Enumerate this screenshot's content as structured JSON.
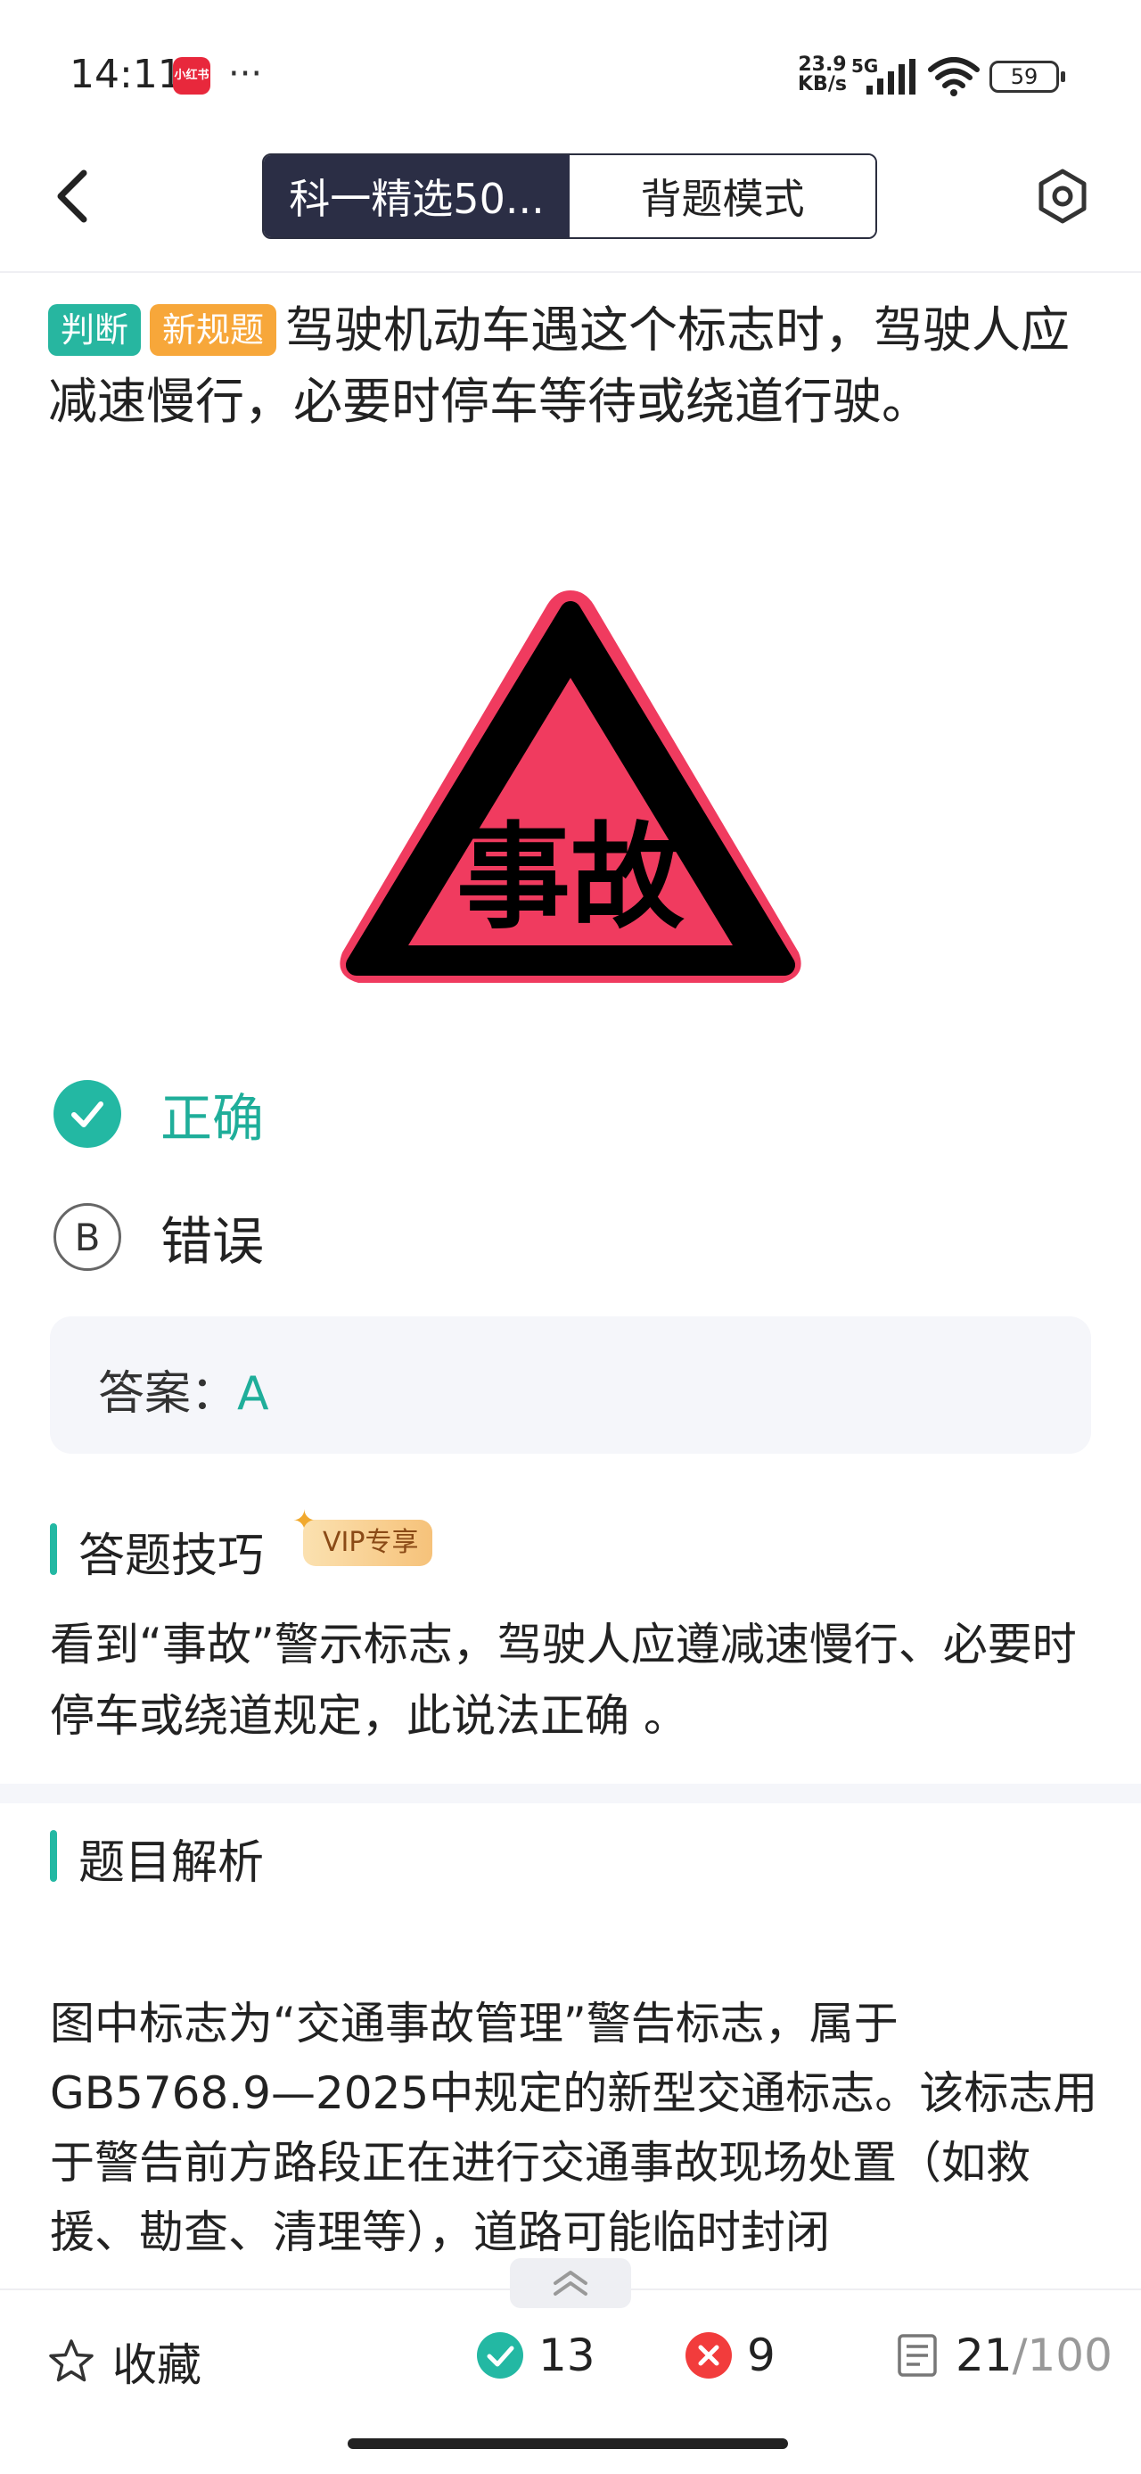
{
  "status_bar": {
    "time": "14:11",
    "app_badge": "小红书",
    "more": "···",
    "net_speed_value": "23.9",
    "net_speed_unit": "KB/s",
    "net_type": "5G",
    "battery": "59"
  },
  "header": {
    "tabs": [
      {
        "label": "科一精选50...",
        "active": true
      },
      {
        "label": "背题模式",
        "active": false
      }
    ]
  },
  "question": {
    "tags": [
      "判断",
      "新规题"
    ],
    "text": "驾驶机动车遇这个标志时，驾驶人应减速慢行，必要时停车等待或绕道行驶。",
    "sign_text": "事故"
  },
  "options": [
    {
      "marker": "A",
      "text": "正确",
      "correct": true
    },
    {
      "marker": "B",
      "text": "错误",
      "correct": false
    }
  ],
  "answer": {
    "label": "答案：",
    "value": "A"
  },
  "tips": {
    "title": "答题技巧",
    "vip": "VIP专享",
    "text": "看到“事故”警示标志，驾驶人应遵减速慢行、必要时停车或绕道规定，此说法正确 。"
  },
  "analysis": {
    "title": "题目解析",
    "text": "图中标志为“交通事故管理”警告标志，属于GB5768.9—2025中规定的新型交通标志。该标志用于警告前方路段正在进行交通事故现场处置（如救援、勘查、清理等），道路可能临时封闭"
  },
  "bottom_bar": {
    "favorite": "收藏",
    "correct_count": "13",
    "wrong_count": "9",
    "progress_current": "21",
    "progress_total": "/100"
  },
  "colors": {
    "accent": "#23b8a3",
    "sign_fill": "#f03b5f",
    "tag_judge": "#27b6a0",
    "tag_new": "#f7a73a",
    "wrong": "#f23c3c"
  }
}
